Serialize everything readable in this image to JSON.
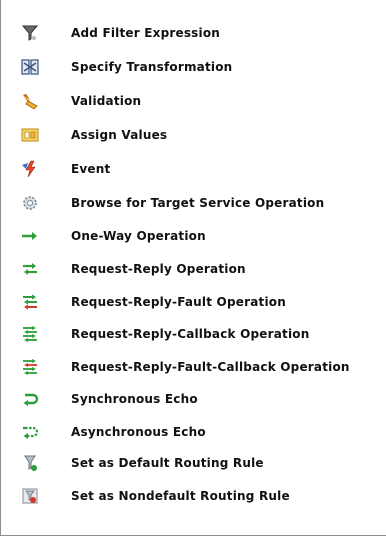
{
  "menu": {
    "items": [
      {
        "label": "Add Filter Expression",
        "icon": "filter-icon"
      },
      {
        "label": "Specify Transformation",
        "icon": "transformation-icon"
      },
      {
        "label": "Validation",
        "icon": "validation-icon"
      },
      {
        "label": "Assign Values",
        "icon": "assign-values-icon"
      },
      {
        "label": "Event",
        "icon": "event-icon"
      },
      {
        "label": "Browse for Target Service Operation",
        "icon": "browse-gear-icon"
      },
      {
        "label": "One-Way Operation",
        "icon": "one-way-arrow-icon"
      },
      {
        "label": "Request-Reply Operation",
        "icon": "request-reply-icon"
      },
      {
        "label": "Request-Reply-Fault Operation",
        "icon": "request-reply-fault-icon"
      },
      {
        "label": "Request-Reply-Callback Operation",
        "icon": "request-reply-callback-icon"
      },
      {
        "label": "Request-Reply-Fault-Callback Operation",
        "icon": "request-reply-fault-callback-icon"
      },
      {
        "label": "Synchronous Echo",
        "icon": "synchronous-echo-icon"
      },
      {
        "label": "Asynchronous Echo",
        "icon": "asynchronous-echo-icon"
      },
      {
        "label": "Set as Default Routing Rule",
        "icon": "default-routing-rule-icon"
      },
      {
        "label": "Set as Nondefault Routing Rule",
        "icon": "nondefault-routing-rule-icon"
      }
    ]
  },
  "colors": {
    "green": "#2e9e3a",
    "red": "#d23a2a",
    "blue": "#3a6fc0",
    "orange": "#f0a020",
    "gray": "#8a8a8a"
  }
}
